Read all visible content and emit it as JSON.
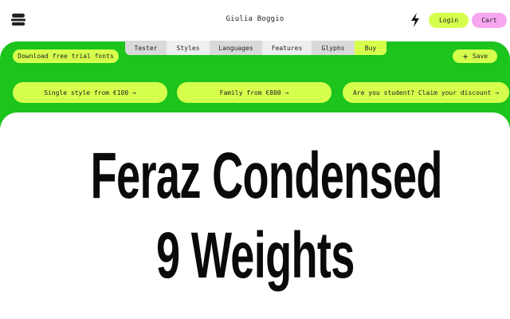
{
  "header": {
    "brand": "Giulia Boggio",
    "login_label": "Login",
    "cart_label": "Cart",
    "menu_icon": "burger-icon",
    "bolt_icon": "lightning-icon"
  },
  "tabs": [
    {
      "label": "Tester"
    },
    {
      "label": "Styles"
    },
    {
      "label": "Languages"
    },
    {
      "label": "Features"
    },
    {
      "label": "Glyphs"
    },
    {
      "label": "Buy"
    }
  ],
  "actions": {
    "download_label": "Download free trial fonts",
    "save_label": "Save",
    "save_icon": "sparkle-icon"
  },
  "pricing": [
    {
      "label": "Single style from €100 →"
    },
    {
      "label": "Family from €800 →"
    },
    {
      "label": "Are you student? Claim your discount →"
    }
  ],
  "display": {
    "line1": "Feraz Condensed",
    "line2": "9 Weights"
  },
  "colors": {
    "green": "#1cc41c",
    "lime": "#d6ff4d",
    "pink": "#f7a6f0"
  }
}
